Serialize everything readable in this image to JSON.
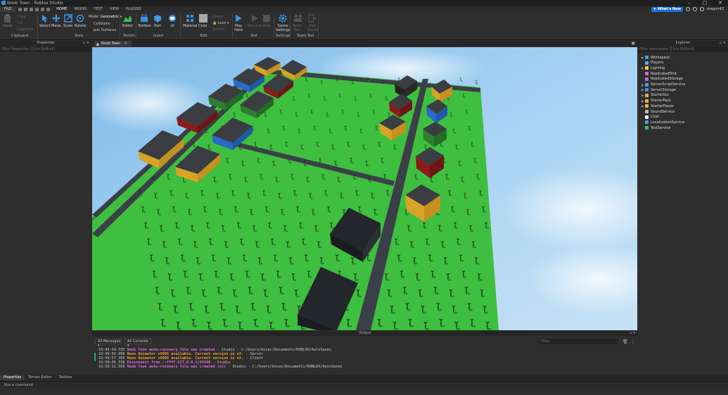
{
  "window": {
    "title": "Noob Town - Roblox Studio"
  },
  "menu": {
    "file": "FILE",
    "tabs": [
      "HOME",
      "MODEL",
      "TEST",
      "VIEW",
      "PLUGINS"
    ],
    "whats_new": "What's New",
    "user": "megvir42"
  },
  "ribbon": {
    "clipboard": {
      "paste": "Paste",
      "copy": "Copy",
      "cut": "Cut",
      "duplicate": "Duplicate",
      "label": "Clipboard"
    },
    "tools": {
      "select": "Select",
      "move": "Move",
      "scale": "Scale",
      "rotate": "Rotate",
      "mode_label": "Mode:",
      "mode_value": "Geometric",
      "collisions": "Collisions",
      "join_surfaces": "Join Surfaces",
      "label": "Tools"
    },
    "terrain": {
      "editor": "Editor",
      "label": "Terrain"
    },
    "insert": {
      "toolbox": "Toolbox",
      "part": "Part",
      "ui": "UI",
      "label": "Insert"
    },
    "edit": {
      "material": "Material",
      "color": "Color",
      "group": "Group",
      "lock": "Lock",
      "anchor": "Anchor",
      "label": "Edit"
    },
    "test": {
      "play_line1": "Play",
      "play_line2": "Here",
      "resume": "Resume",
      "stop": "Stop",
      "label": "Test"
    },
    "settings": {
      "game_line1": "Game",
      "game_line2": "Settings",
      "label": "Settings"
    },
    "team_test": {
      "team": "Team",
      "test": "Test",
      "exit_line1": "Exit",
      "exit_line2": "Game",
      "label": "Team Test"
    }
  },
  "properties": {
    "title": "Properties",
    "filter_placeholder": "Filter Properties (Ctrl+Shift+P)"
  },
  "explorer": {
    "title": "Explorer",
    "filter_placeholder": "Filter workspace (Ctrl+Shift+X)",
    "items": [
      {
        "name": "Workspace",
        "color": "#4aa0e8",
        "expand": true
      },
      {
        "name": "Players",
        "color": "#5db0f0",
        "expand": false
      },
      {
        "name": "Lighting",
        "color": "#f0d040",
        "expand": true
      },
      {
        "name": "ReplicatedFirst",
        "color": "#d06ad0",
        "expand": false
      },
      {
        "name": "ReplicatedStorage",
        "color": "#b070d0",
        "expand": false
      },
      {
        "name": "ServerScriptService",
        "color": "#4aa0e8",
        "expand": true
      },
      {
        "name": "ServerStorage",
        "color": "#4a90d8",
        "expand": true
      },
      {
        "name": "StarterGui",
        "color": "#e8b040",
        "expand": true
      },
      {
        "name": "StarterPack",
        "color": "#e8b040",
        "expand": true
      },
      {
        "name": "StarterPlayer",
        "color": "#e8b040",
        "expand": true
      },
      {
        "name": "SoundService",
        "color": "#bbbbbb",
        "expand": false
      },
      {
        "name": "Chat",
        "color": "#ffffff",
        "expand": false
      },
      {
        "name": "LocalizationService",
        "color": "#4aa0e8",
        "expand": false
      },
      {
        "name": "TestService",
        "color": "#3cc060",
        "expand": false
      }
    ]
  },
  "document": {
    "tab": "Noob Town"
  },
  "output": {
    "title": "Output",
    "messages_dd": "All Messages",
    "contexts_dd": "All Contexts",
    "filter_placeholder": "Filter...",
    "lines": [
      {
        "time": "19:49:54.735",
        "msg": "Noob Town auto-recovery file was created",
        "src": "  -  Studio - C:/Users/kovac/Documents/ROBLOX/AutoSaves",
        "color": "#e070e0"
      },
      {
        "time": "19:49:56.999",
        "msg": "Noon Animator v6006 available. Current version is v2.",
        "src": "  -  Server",
        "color": "#f0a030"
      },
      {
        "time": "19:49:57.366",
        "msg": "Noon Animator v6006 available. Current version is v2.",
        "src": "  -  Client",
        "color": "#f0a030"
      },
      {
        "time": "19:50:05.338",
        "msg": "Disconnect from ::ffff:127.0.0.1|64340",
        "src": "  -  Studio",
        "color": "#e070e0"
      },
      {
        "time": "19:50:11.599",
        "msg": "Noob Town auto-recovery file was created (x2)",
        "src": "  -  Studio - C:/Users/kovac/Documents/ROBLOX/AutoSaves",
        "color": "#e070e0"
      }
    ]
  },
  "bottom_tabs": [
    "Properties",
    "Terrain Editor",
    "Toolbox"
  ],
  "command_bar": {
    "placeholder": "Run a command"
  }
}
